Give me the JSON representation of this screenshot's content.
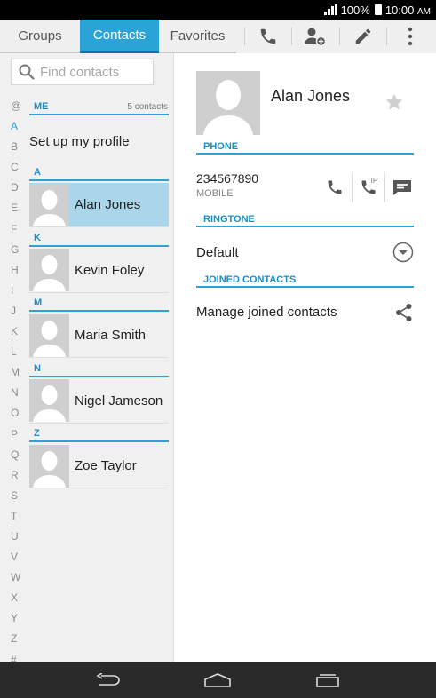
{
  "status": {
    "battery": "100%",
    "time_main": "10:00",
    "time_suffix": "AM"
  },
  "tabs": [
    {
      "label": "Groups"
    },
    {
      "label": "Contacts"
    },
    {
      "label": "Favorites"
    }
  ],
  "search": {
    "placeholder": "Find contacts"
  },
  "alpha_index": [
    "@",
    "A",
    "B",
    "C",
    "D",
    "E",
    "F",
    "G",
    "H",
    "I",
    "J",
    "K",
    "L",
    "M",
    "N",
    "O",
    "P",
    "Q",
    "R",
    "S",
    "T",
    "U",
    "V",
    "W",
    "X",
    "Y",
    "Z",
    "#"
  ],
  "list": {
    "me_header": "ME",
    "contact_count": "5 contacts",
    "setup_profile": "Set up my profile",
    "sections": [
      {
        "letter": "A",
        "name": "Alan Jones"
      },
      {
        "letter": "K",
        "name": "Kevin Foley"
      },
      {
        "letter": "M",
        "name": "Maria Smith"
      },
      {
        "letter": "N",
        "name": "Nigel Jameson"
      },
      {
        "letter": "Z",
        "name": "Zoe Taylor"
      }
    ]
  },
  "detail": {
    "name": "Alan Jones",
    "phone_header": "PHONE",
    "phone_number": "234567890",
    "phone_type": "MOBILE",
    "ip_label": "IP",
    "ringtone_header": "RINGTONE",
    "ringtone_value": "Default",
    "joined_header": "JOINED CONTACTS",
    "manage_joined": "Manage joined contacts"
  },
  "colors": {
    "accent": "#2aa3d6",
    "selected_row": "#a9d6ea"
  }
}
